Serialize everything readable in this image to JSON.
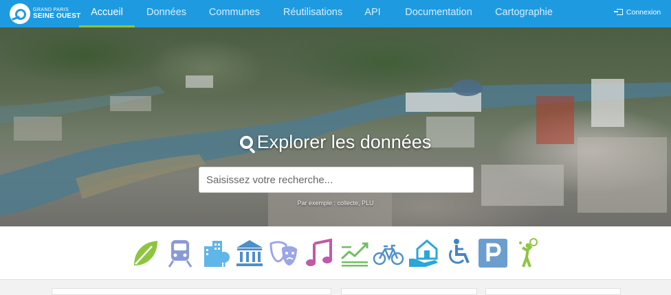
{
  "brand": {
    "line1": "GRAND PARIS",
    "line2": "SEINE OUEST"
  },
  "nav": {
    "items": [
      {
        "label": "Accueil",
        "active": true
      },
      {
        "label": "Données",
        "active": false
      },
      {
        "label": "Communes",
        "active": false
      },
      {
        "label": "Réutilisations",
        "active": false
      },
      {
        "label": "API",
        "active": false
      },
      {
        "label": "Documentation",
        "active": false
      },
      {
        "label": "Cartographie",
        "active": false
      }
    ],
    "login_label": "Connexion",
    "accent_color": "#1e9be0",
    "active_underline_color": "#8cc63f"
  },
  "hero": {
    "title": "Explorer les données",
    "search_placeholder": "Saisissez votre recherche...",
    "hint": "Par exemple : collecte, PLU"
  },
  "themes": [
    {
      "icon": "leaf-icon",
      "color": "#8cc63f"
    },
    {
      "icon": "train-icon",
      "color": "#8a9ad8"
    },
    {
      "icon": "buildings-icon",
      "color": "#5fb6e8"
    },
    {
      "icon": "museum-icon",
      "color": "#4d8fc9"
    },
    {
      "icon": "theater-masks-icon",
      "color": "#9aa6e8"
    },
    {
      "icon": "music-note-icon",
      "color": "#c05aa9"
    },
    {
      "icon": "chart-trend-icon",
      "color": "#6fbf60"
    },
    {
      "icon": "bicycle-icon",
      "color": "#4d8fc9"
    },
    {
      "icon": "house-hand-icon",
      "color": "#2aa6d8"
    },
    {
      "icon": "wheelchair-icon",
      "color": "#3f86c6"
    },
    {
      "icon": "parking-icon",
      "color": "#6b9ecf"
    },
    {
      "icon": "tennis-player-icon",
      "color": "#8cc63f"
    }
  ]
}
